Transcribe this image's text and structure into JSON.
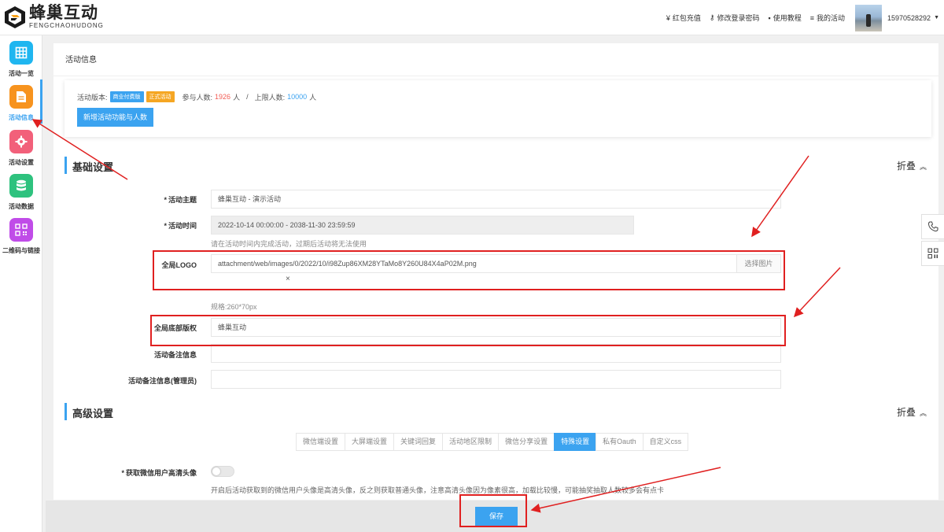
{
  "header": {
    "logo_cn": "蜂巢互动",
    "logo_en": "FENGCHAOHUDONG",
    "nav": [
      {
        "icon": "yen-icon",
        "glyph": "¥",
        "label": "红包充值"
      },
      {
        "icon": "key-icon",
        "glyph": "⚷",
        "label": "修改登录密码"
      },
      {
        "icon": "document-icon",
        "glyph": "▪",
        "label": "使用教程"
      },
      {
        "icon": "list-icon",
        "glyph": "≡",
        "label": "我的活动"
      }
    ],
    "username": "15970528292"
  },
  "sidebar": {
    "items": [
      {
        "label": "活动一览",
        "icon": "grid-icon",
        "color": "#1fb6f0"
      },
      {
        "label": "活动信息",
        "icon": "document-icon",
        "color": "#f7931e"
      },
      {
        "label": "活动设置",
        "icon": "gear-icon",
        "color": "#f2607a"
      },
      {
        "label": "活动数据",
        "icon": "database-icon",
        "color": "#2ec27e"
      },
      {
        "label": "二维码与链接",
        "icon": "qrcode-icon",
        "color": "#c04ce8"
      }
    ],
    "active_index": 1
  },
  "main": {
    "page_title": "活动信息",
    "info": {
      "version_label": "活动版本:",
      "tag_paid": "商业付费版",
      "tag_formal": "正式活动",
      "participants_label": "参与人数:",
      "participants_value": "1926",
      "participants_unit": "人",
      "separator": "/",
      "limit_label": "上限人数:",
      "limit_value": "10000",
      "limit_unit": "人",
      "add_button": "新增活动功能与人数"
    },
    "basic": {
      "title": "基础设置",
      "fold": "折叠",
      "subject_label": "活动主题",
      "subject_value": "蜂巢互动 - 演示活动",
      "time_label": "活动时间",
      "time_value": "2022-10-14 00:00:00 - 2038-11-30 23:59:59",
      "time_hint": "请在活动时间内完成活动，过期后活动将无法使用",
      "logo_label": "全局LOGO",
      "logo_value": "attachment/web/images/0/2022/10/i98Zup86XM28YTaMo8Y260U84X4aP02M.png",
      "logo_pick": "选择图片",
      "logo_remove": "×",
      "logo_spec": "规格:260*70px",
      "copyright_label": "全局底部版权",
      "copyright_value": "蜂巢互动",
      "remark_label": "活动备注信息",
      "remark_value": "",
      "admin_remark_label": "活动备注信息(管理员)",
      "admin_remark_value": ""
    },
    "advanced": {
      "title": "高级设置",
      "fold": "折叠",
      "tabs": [
        "微信端设置",
        "大屏端设置",
        "关键词回复",
        "活动地区限制",
        "微信分享设置",
        "特殊设置",
        "私有Oauth",
        "自定义css"
      ],
      "active_tab": 5,
      "avatar_label": "获取微信用户高清头像",
      "avatar_toggle": false,
      "avatar_hint": "开启后活动获取到的微信用户头像是高清头像，反之则获取普通头像，注意高清头像因为像素很高，加载比较慢，可能抽奖抽取人数较多会有点卡"
    }
  },
  "footer": {
    "save": "保存"
  },
  "floating": [
    {
      "icon": "phone-icon"
    },
    {
      "icon": "qrcode-icon"
    }
  ],
  "colors": {
    "accent": "#3ba3f0",
    "annotation": "#e02020",
    "orange": "#f5a623",
    "red_number": "#f25c54"
  }
}
